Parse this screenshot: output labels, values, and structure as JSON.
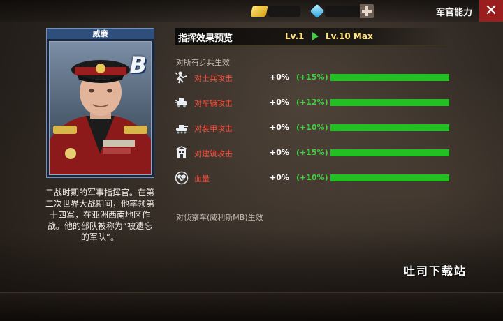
{
  "header": {
    "panel_title": "军官能力",
    "resources": [
      {
        "icon": "gold-bar-icon"
      },
      {
        "icon": "gem-icon"
      }
    ]
  },
  "officer": {
    "name": "威廉",
    "grade": "B",
    "bio": "二战时期的军事指挥官。在第二次世界大战期间，他率领第十四军，在亚洲西南地区作战。他的部队被称为“被遗忘的军队”。"
  },
  "stats_panel": {
    "title": "指挥效果预览",
    "level_from": "Lv.1",
    "level_to": "Lv.10 Max",
    "section_label": "对所有步兵生效",
    "rows": [
      {
        "name": "对士兵攻击",
        "current": "+0%",
        "max": "(+15%)",
        "icon": "soldier-attack-icon",
        "fill": 1
      },
      {
        "name": "对车辆攻击",
        "current": "+0%",
        "max": "(+12%)",
        "icon": "vehicle-attack-icon",
        "fill": 1
      },
      {
        "name": "对装甲攻击",
        "current": "+0%",
        "max": "(+10%)",
        "icon": "armor-attack-icon",
        "fill": 1
      },
      {
        "name": "对建筑攻击",
        "current": "+0%",
        "max": "(+15%)",
        "icon": "building-attack-icon",
        "fill": 1
      },
      {
        "name": "血量",
        "current": "+0%",
        "max": "(+10%)",
        "icon": "heart-icon",
        "fill": 1
      }
    ],
    "footer_label": "对侦察车(威利斯MB)生效"
  },
  "watermark": "吐司下载站",
  "colors": {
    "accent_green": "#22c022",
    "stat_name_red": "#ff4b3c",
    "level_gold": "#ffe27a",
    "close_red": "#9b1e1e"
  }
}
